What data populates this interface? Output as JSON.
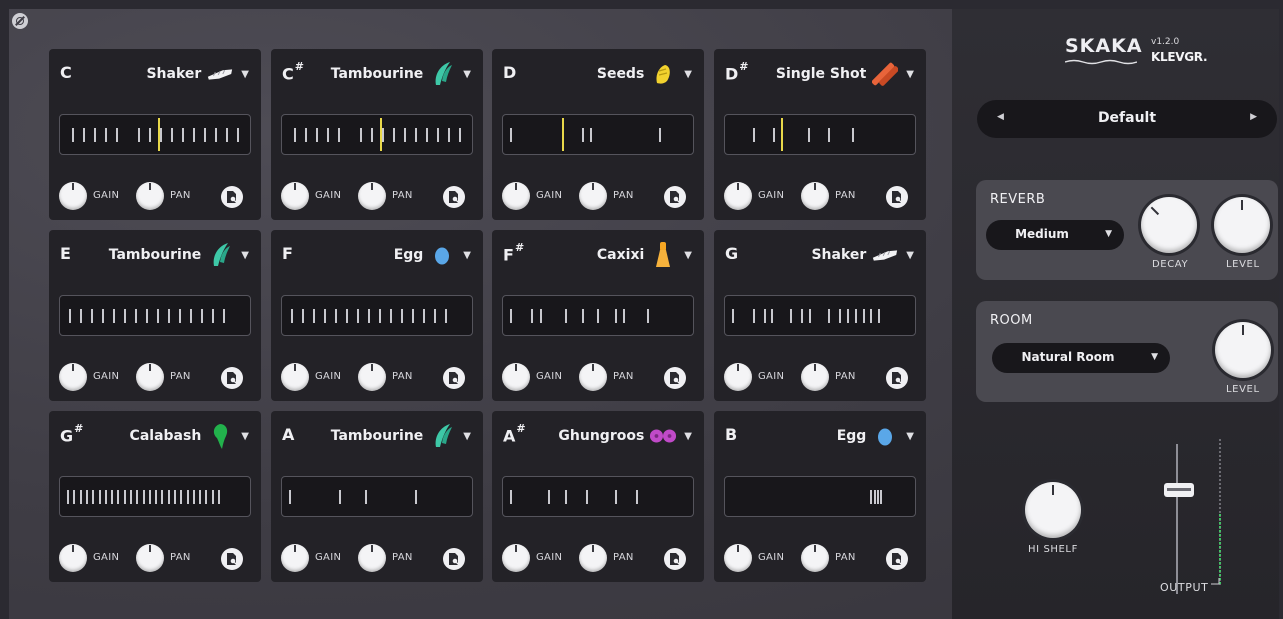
{
  "pads": [
    {
      "note": "C",
      "sharp": false,
      "instrument": "Shaker",
      "icon": "shaker-icon",
      "ticks": [
        5,
        12,
        19,
        26,
        33,
        47,
        54,
        61,
        68,
        75,
        82,
        89,
        96,
        103,
        110
      ],
      "playhead": 60
    },
    {
      "note": "C",
      "sharp": true,
      "instrument": "Tambourine",
      "icon": "tambourine-icon",
      "ticks": [
        5,
        12,
        19,
        26,
        33,
        47,
        54,
        61,
        68,
        75,
        82,
        89,
        96,
        103,
        110
      ],
      "playhead": 60
    },
    {
      "note": "D",
      "sharp": false,
      "instrument": "Seeds",
      "icon": "seeds-icon",
      "ticks": [
        2,
        48,
        53,
        97
      ],
      "playhead": 35
    },
    {
      "note": "D",
      "sharp": true,
      "instrument": "Single Shot",
      "icon": "single-shot-icon",
      "ticks": [
        15,
        28,
        50,
        63,
        78
      ],
      "playhead": 33
    },
    {
      "note": "E",
      "sharp": false,
      "instrument": "Tambourine",
      "icon": "tambourine-icon",
      "ticks": [
        3,
        10,
        17,
        24,
        31,
        38,
        45,
        52,
        59,
        66,
        73,
        80,
        87,
        94,
        101
      ],
      "playhead": null
    },
    {
      "note": "F",
      "sharp": false,
      "instrument": "Egg",
      "icon": "egg-icon",
      "ticks": [
        3,
        10,
        17,
        24,
        31,
        38,
        45,
        52,
        59,
        66,
        73,
        80,
        87,
        94,
        101
      ],
      "playhead": null
    },
    {
      "note": "F",
      "sharp": true,
      "instrument": "Caxixi",
      "icon": "caxixi-icon",
      "ticks": [
        2,
        15,
        21,
        37,
        48,
        57,
        69,
        74,
        89
      ],
      "playhead": null
    },
    {
      "note": "G",
      "sharp": false,
      "instrument": "Shaker",
      "icon": "shaker-icon",
      "ticks": [
        2,
        15,
        22,
        27,
        39,
        46,
        51,
        63,
        70,
        75,
        80,
        85,
        90,
        95
      ],
      "playhead": null
    },
    {
      "note": "G",
      "sharp": true,
      "instrument": "Calabash",
      "icon": "calabash-icon",
      "ticks": [
        2,
        6,
        10,
        14,
        18,
        22,
        26,
        30,
        34,
        38,
        42,
        46,
        50,
        54,
        58,
        62,
        66,
        70,
        74,
        78,
        82,
        86,
        90,
        94,
        98
      ],
      "playhead": null
    },
    {
      "note": "A",
      "sharp": false,
      "instrument": "Tambourine",
      "icon": "tambourine-icon",
      "ticks": [
        2,
        34,
        50,
        82
      ],
      "playhead": null
    },
    {
      "note": "A",
      "sharp": true,
      "instrument": "Ghungroos",
      "icon": "ghungroos-icon",
      "ticks": [
        2,
        26,
        37,
        50,
        69,
        82
      ],
      "playhead": null
    },
    {
      "note": "B",
      "sharp": false,
      "instrument": "Egg",
      "icon": "egg-icon",
      "ticks": [
        90,
        92,
        94,
        96
      ],
      "playhead": null
    }
  ],
  "labels": {
    "gain": "GAIN",
    "pan": "PAN"
  },
  "right": {
    "logo": "SKAKA",
    "version": "v1.2.0",
    "brand": "KLEVGR.",
    "preset": "Default",
    "reverb": {
      "title": "REVERB",
      "type": "Medium",
      "decay_label": "DECAY",
      "level_label": "LEVEL"
    },
    "room": {
      "title": "ROOM",
      "type": "Natural Room",
      "level_label": "LEVEL"
    },
    "hi_shelf_label": "HI SHELF",
    "output_label": "OUTPUT"
  },
  "colors": {
    "playhead": "#e8d84a",
    "meter": "#3fc463"
  }
}
